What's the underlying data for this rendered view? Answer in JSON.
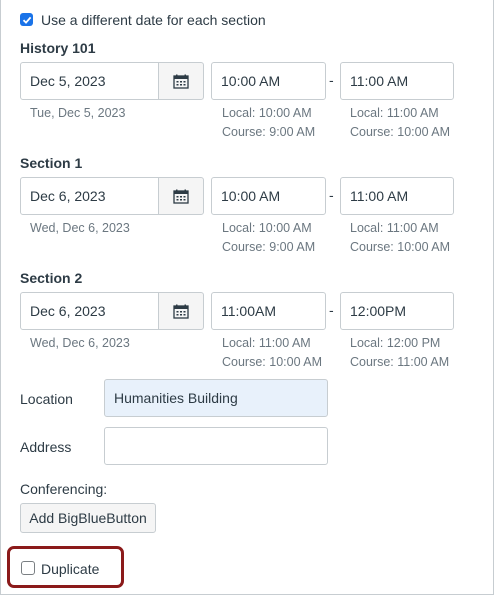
{
  "top_checkbox": {
    "label": "Use a different date for each section",
    "checked": true
  },
  "sections": [
    {
      "title": "History 101",
      "date_value": "Dec 5, 2023",
      "date_hint": "Tue, Dec 5, 2023",
      "start_time": "10:00 AM",
      "end_time": "11:00 AM",
      "start_local": "Local: 10:00 AM",
      "start_course": "Course: 9:00 AM",
      "end_local": "Local: 11:00 AM",
      "end_course": "Course: 10:00 AM"
    },
    {
      "title": "Section 1",
      "date_value": "Dec 6, 2023",
      "date_hint": "Wed, Dec 6, 2023",
      "start_time": "10:00 AM",
      "end_time": "11:00 AM",
      "start_local": "Local: 10:00 AM",
      "start_course": "Course: 9:00 AM",
      "end_local": "Local: 11:00 AM",
      "end_course": "Course: 10:00 AM"
    },
    {
      "title": "Section 2",
      "date_value": "Dec 6, 2023",
      "date_hint": "Wed, Dec 6, 2023",
      "start_time": "11:00AM",
      "end_time": "12:00PM",
      "start_local": "Local: 11:00 AM",
      "start_course": "Course: 10:00 AM",
      "end_local": "Local: 12:00 PM",
      "end_course": "Course: 11:00 AM"
    }
  ],
  "time_separator": "-",
  "location": {
    "label": "Location",
    "value": "Humanities Building"
  },
  "address": {
    "label": "Address",
    "value": ""
  },
  "conferencing": {
    "label": "Conferencing:",
    "button_label": "Add BigBlueButton"
  },
  "duplicate": {
    "label": "Duplicate",
    "checked": false
  },
  "colors": {
    "checkbox_accent": "#1a73e8",
    "highlight_border": "#8b1a1a",
    "location_bg": "#e8f1fb"
  }
}
